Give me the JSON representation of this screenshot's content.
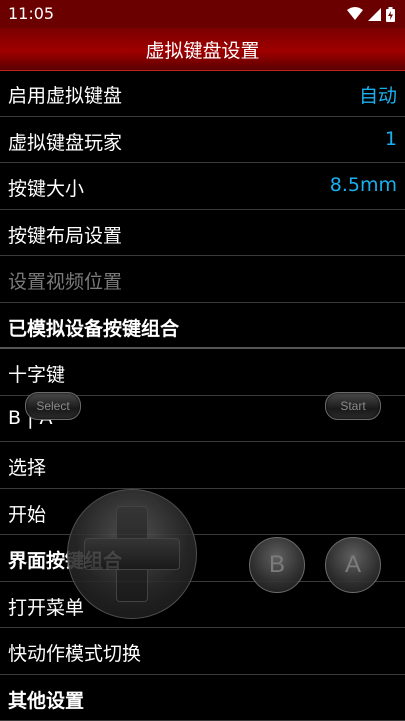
{
  "status_bar": {
    "time": "11:05"
  },
  "app_bar": {
    "title": "虚拟键盘设置"
  },
  "settings": {
    "rows": [
      {
        "label": "启用虚拟键盘",
        "value": "自动"
      },
      {
        "label": "虚拟键盘玩家",
        "value": "1"
      },
      {
        "label": "按键大小",
        "value": "8.5mm"
      },
      {
        "label": "按键布局设置"
      },
      {
        "label": "设置视频位置"
      },
      {
        "label": "已模拟设备按键组合"
      },
      {
        "label": "十字键"
      },
      {
        "label": "B | A"
      },
      {
        "label": "选择"
      },
      {
        "label": "开始"
      },
      {
        "label": "界面按键组合"
      },
      {
        "label": "打开菜单"
      },
      {
        "label": "快动作模式切换"
      },
      {
        "label": "其他设置"
      }
    ]
  },
  "overlay": {
    "select_label": "Select",
    "start_label": "Start",
    "b_label": "B",
    "a_label": "A"
  }
}
